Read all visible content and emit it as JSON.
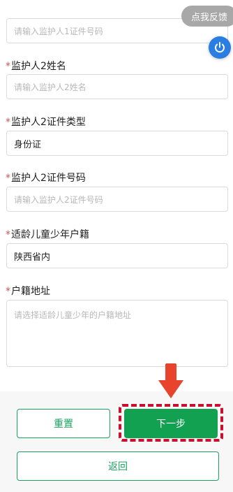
{
  "overlay": {
    "feedback_label": "点我反馈",
    "power_icon": "power-icon"
  },
  "fields": {
    "guardian1_id_number": {
      "placeholder": "请输入监护人1证件号码"
    },
    "guardian2_name": {
      "label": "监护人2姓名",
      "placeholder": "请输入监护人2姓名"
    },
    "guardian2_id_type": {
      "label": "监护人2证件类型",
      "value": "身份证"
    },
    "guardian2_id_number": {
      "label": "监护人2证件号码",
      "placeholder": "请输入监护人2证件号码"
    },
    "child_household": {
      "label": "适龄儿童少年户籍",
      "value": "陕西省内"
    },
    "household_address": {
      "label": "户籍地址",
      "placeholder": "请选择适龄儿童少年的户籍地址"
    },
    "required_mark": "*"
  },
  "actions": {
    "reset_label": "重置",
    "next_label": "下一步",
    "back_label": "返回"
  },
  "colors": {
    "accent_green": "#12a150",
    "required_red": "#d9534f",
    "highlight_red": "#c8102e",
    "arrow_red": "#e8432c",
    "power_blue": "#2a7de1"
  }
}
